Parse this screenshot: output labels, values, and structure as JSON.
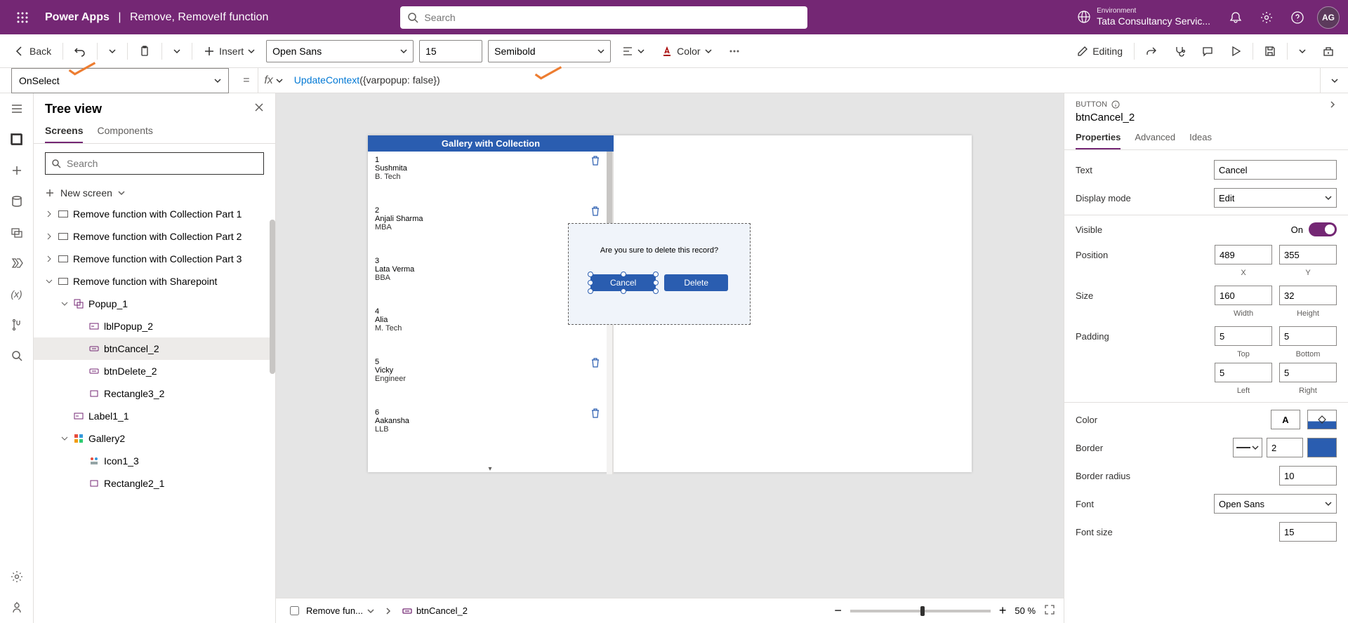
{
  "header": {
    "app_name": "Power Apps",
    "separator": "|",
    "file_name": "Remove, RemoveIf function",
    "search_placeholder": "Search",
    "env_label": "Environment",
    "env_name": "Tata Consultancy Servic...",
    "avatar_initials": "AG"
  },
  "toolbar": {
    "back": "Back",
    "insert": "Insert",
    "font": "Open Sans",
    "font_size": "15",
    "font_weight": "Semibold",
    "color_label": "Color",
    "editing": "Editing"
  },
  "formula": {
    "property": "OnSelect",
    "fx": "fx",
    "fn_name": "UpdateContext",
    "open": "({",
    "prop_name": "varpopup:",
    "space": " ",
    "bool_val": "false",
    "close": "})"
  },
  "tree": {
    "title": "Tree view",
    "tab_screens": "Screens",
    "tab_components": "Components",
    "search_placeholder": "Search",
    "new_screen": "New screen",
    "items": [
      {
        "label": "Remove function with Collection Part 1",
        "type": "screen",
        "indent": 0,
        "expanded": false,
        "chev": true
      },
      {
        "label": "Remove function with Collection Part 2",
        "type": "screen",
        "indent": 0,
        "expanded": false,
        "chev": true
      },
      {
        "label": "Remove function with Collection Part 3",
        "type": "screen",
        "indent": 0,
        "expanded": false,
        "chev": true
      },
      {
        "label": "Remove function with Sharepoint",
        "type": "screen",
        "indent": 0,
        "expanded": true,
        "chev": true
      },
      {
        "label": "Popup_1",
        "type": "group",
        "indent": 1,
        "expanded": true,
        "chev": true
      },
      {
        "label": "lblPopup_2",
        "type": "label",
        "indent": 2,
        "chev": false
      },
      {
        "label": "btnCancel_2",
        "type": "button",
        "indent": 2,
        "chev": false,
        "selected": true
      },
      {
        "label": "btnDelete_2",
        "type": "button",
        "indent": 2,
        "chev": false
      },
      {
        "label": "Rectangle3_2",
        "type": "rect",
        "indent": 2,
        "chev": false
      },
      {
        "label": "Label1_1",
        "type": "label",
        "indent": 1,
        "chev": false
      },
      {
        "label": "Gallery2",
        "type": "gallery",
        "indent": 1,
        "expanded": true,
        "chev": true
      },
      {
        "label": "Icon1_3",
        "type": "icon",
        "indent": 2,
        "chev": false
      },
      {
        "label": "Rectangle2_1",
        "type": "rect",
        "indent": 2,
        "chev": false
      }
    ]
  },
  "canvas": {
    "gallery_title": "Gallery with Collection",
    "records": [
      {
        "idx": "1",
        "name": "Sushmita",
        "deg": "B. Tech"
      },
      {
        "idx": "2",
        "name": "Anjali Sharma",
        "deg": "MBA"
      },
      {
        "idx": "3",
        "name": "Lata Verma",
        "deg": "BBA"
      },
      {
        "idx": "4",
        "name": "Alia",
        "deg": "M. Tech"
      },
      {
        "idx": "5",
        "name": "Vicky",
        "deg": "Engineer"
      },
      {
        "idx": "6",
        "name": "Aakansha",
        "deg": "LLB"
      }
    ],
    "popup_text": "Are you sure to delete this record?",
    "cancel_btn": "Cancel",
    "delete_btn": "Delete"
  },
  "breadcrumb": {
    "screen": "Remove fun...",
    "control": "btnCancel_2"
  },
  "zoom": {
    "value": "50",
    "pct": "%"
  },
  "props": {
    "type": "BUTTON",
    "name": "btnCancel_2",
    "tab_properties": "Properties",
    "tab_advanced": "Advanced",
    "tab_ideas": "Ideas",
    "text_label": "Text",
    "text_value": "Cancel",
    "display_mode_label": "Display mode",
    "display_mode_value": "Edit",
    "visible_label": "Visible",
    "visible_value": "On",
    "position_label": "Position",
    "position_x": "489",
    "position_y": "355",
    "x_label": "X",
    "y_label": "Y",
    "size_label": "Size",
    "size_w": "160",
    "size_h": "32",
    "w_label": "Width",
    "h_label": "Height",
    "padding_label": "Padding",
    "pad_top": "5",
    "pad_bottom": "5",
    "pad_left": "5",
    "pad_right": "5",
    "top_label": "Top",
    "bottom_label": "Bottom",
    "left_label": "Left",
    "right_label": "Right",
    "color_label": "Color",
    "border_label": "Border",
    "border_value": "2",
    "border_radius_label": "Border radius",
    "border_radius_value": "10",
    "font_label": "Font",
    "font_value": "Open Sans",
    "font_size_label": "Font size",
    "font_size_value": "15"
  }
}
